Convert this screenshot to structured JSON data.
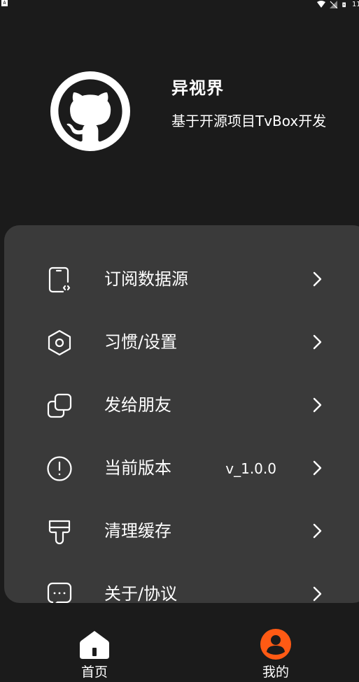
{
  "status_bar": {
    "left_glyph": "A",
    "time": "11"
  },
  "profile": {
    "name": "异视界",
    "description": "基于开源项目TvBox开发"
  },
  "menu": [
    {
      "id": "subscribe",
      "label": "订阅数据源",
      "value": "",
      "icon": "phone-code-icon"
    },
    {
      "id": "settings",
      "label": "习惯/设置",
      "value": "",
      "icon": "hexagon-settings-icon"
    },
    {
      "id": "share",
      "label": "发给朋友",
      "value": "",
      "icon": "copy-squares-icon"
    },
    {
      "id": "version",
      "label": "当前版本",
      "value": "v_1.0.0",
      "icon": "info-circle-icon"
    },
    {
      "id": "cache",
      "label": "清理缓存",
      "value": "",
      "icon": "brush-icon"
    },
    {
      "id": "about",
      "label": "关于/协议",
      "value": "",
      "icon": "chat-dots-icon"
    }
  ],
  "bottom_nav": [
    {
      "label": "首页",
      "icon": "home-icon",
      "active": false
    },
    {
      "label": "我的",
      "icon": "user-icon",
      "active": true
    }
  ],
  "colors": {
    "background": "#1b1b1b",
    "card": "#3a3a3a",
    "accent": "#ff5a14"
  }
}
